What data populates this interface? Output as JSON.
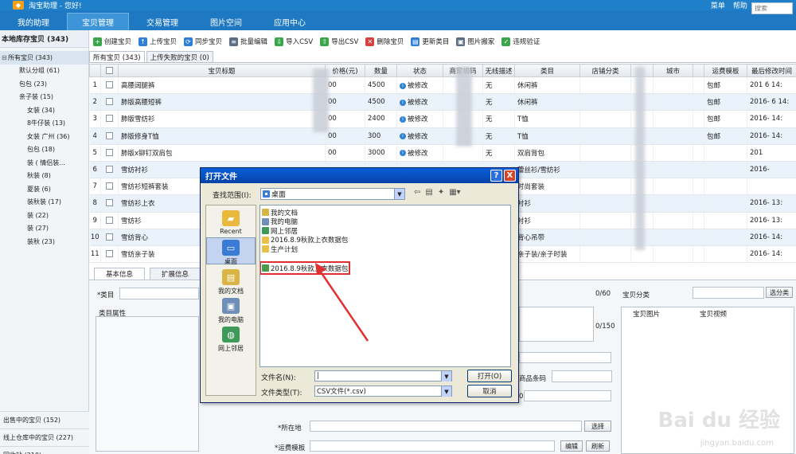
{
  "titlebar": {
    "title": "淘宝助理 - 您好!",
    "menu": "菜单",
    "help": "帮助"
  },
  "nav": {
    "tabs": [
      "我的助理",
      "宝贝管理",
      "交易管理",
      "图片空间",
      "应用中心"
    ],
    "active_index": 1
  },
  "left": {
    "header": "本地库存宝贝 (343)",
    "tree": [
      {
        "label": "所有宝贝 (343)",
        "root": true
      },
      {
        "label": "默认分组 (61)"
      },
      {
        "label": "包包 (23)"
      },
      {
        "label": "亲子装 (15)"
      },
      {
        "label": "女装 (34)"
      },
      {
        "label": "8牛仔装 (13)"
      },
      {
        "label": "女装 广州 (36)"
      },
      {
        "label": "包包 (18)"
      },
      {
        "label": "装 ( 情侣装..."
      },
      {
        "label": "秋装 (8)"
      },
      {
        "label": "夏装 (6)"
      },
      {
        "label": "装秋装 (17)"
      },
      {
        "label": "装 (22)"
      },
      {
        "label": "装 (27)"
      },
      {
        "label": "装秋 (23)"
      }
    ],
    "bottom": [
      "出售中的宝贝 (152)",
      "线上仓库中的宝贝 (227)",
      "回收站 (210)"
    ]
  },
  "toolbar": {
    "buttons": [
      {
        "label": "创建宝贝",
        "color": "#3aa64c",
        "glyph": "+"
      },
      {
        "label": "上传宝贝",
        "color": "#2f7fd6",
        "glyph": "↑"
      },
      {
        "label": "同步宝贝",
        "color": "#2f7fd6",
        "glyph": "⟳"
      },
      {
        "label": "批量编辑",
        "color": "#5a6d82",
        "glyph": "≡"
      },
      {
        "label": "导入CSV",
        "color": "#3aa64c",
        "glyph": "⇩"
      },
      {
        "label": "导出CSV",
        "color": "#3aa64c",
        "glyph": "⇧"
      },
      {
        "label": "删除宝贝",
        "color": "#d84040",
        "glyph": "✕"
      },
      {
        "label": "更新类目",
        "color": "#2f7fd6",
        "glyph": "▤"
      },
      {
        "label": "图片搬家",
        "color": "#5a6d82",
        "glyph": "▣"
      },
      {
        "label": "违规验证",
        "color": "#3aa64c",
        "glyph": "✓"
      }
    ],
    "search_placeholder": "搜索"
  },
  "subtabs": [
    "所有宝贝 (343)",
    "上传失败的宝贝 (0)"
  ],
  "grid": {
    "headers": [
      "",
      "",
      "宝贝标题",
      "价格(元)",
      "数量",
      "状态",
      "商家编码",
      "无线描述",
      "类目",
      "店铺分类",
      "",
      "城市",
      "",
      "运费模板",
      "最后修改时间"
    ],
    "rows": [
      {
        "n": "1",
        "title": "高腰阔腿裤",
        "price": "00",
        "qty": "4500",
        "status": "被修改",
        "code": "",
        "wireless": "无",
        "cat": "休闲裤",
        "ship": "包邮",
        "time": "201    6  14:"
      },
      {
        "n": "2",
        "title": "肺版高腰短裤",
        "price": "00",
        "qty": "4500",
        "status": "被修改",
        "code": "",
        "wireless": "无",
        "cat": "休闲裤",
        "ship": "包邮",
        "time": "2016-  6  14:"
      },
      {
        "n": "3",
        "title": "肺版雪纺衫",
        "price": "00",
        "qty": "2400",
        "status": "被修改",
        "code": "",
        "wireless": "无",
        "cat": "T恤",
        "ship": "包邮",
        "time": "2016-   14:"
      },
      {
        "n": "4",
        "title": "肺版修身T恤",
        "price": "00",
        "qty": "300",
        "status": "被修改",
        "code": "",
        "wireless": "无",
        "cat": "T恤",
        "ship": "包邮",
        "time": "2016-   14:"
      },
      {
        "n": "5",
        "title": "肺版x铆钉双肩包",
        "price": "00",
        "qty": "3000",
        "status": "被修改",
        "code": "",
        "wireless": "无",
        "cat": "双肩背包",
        "ship": "",
        "time": "201"
      },
      {
        "n": "6",
        "title": "雪纺衬衫",
        "price": "",
        "qty": "",
        "status": "",
        "code": "",
        "wireless": "",
        "cat": "蕾丝衫/雪纺衫",
        "ship": "",
        "time": "2016-"
      },
      {
        "n": "7",
        "title": "雪纺衫短裤套装",
        "price": "",
        "qty": "",
        "status": "",
        "code": "",
        "wireless": "",
        "cat": "时尚套装",
        "ship": "",
        "time": ""
      },
      {
        "n": "8",
        "title": "雪纺衫上衣",
        "price": "",
        "qty": "",
        "status": "",
        "code": "",
        "wireless": "",
        "cat": "衬衫",
        "ship": "",
        "time": "2016-   13:"
      },
      {
        "n": "9",
        "title": "雪纺衫",
        "price": "",
        "qty": "",
        "status": "",
        "code": "",
        "wireless": "",
        "cat": "衬衫",
        "ship": "",
        "time": "2016-   13:"
      },
      {
        "n": "10",
        "title": "雪纺背心",
        "price": "",
        "qty": "",
        "status": "",
        "code": "",
        "wireless": "",
        "cat": "背心吊带",
        "ship": "",
        "time": "2016-   14:"
      },
      {
        "n": "11",
        "title": "雪纺亲子装",
        "price": "",
        "qty": "",
        "status": "",
        "code": "",
        "wireless": "",
        "cat": "亲子装/亲子时装",
        "ship": "",
        "time": "2016-   14:"
      }
    ]
  },
  "edit": {
    "tabs": [
      "基本信息",
      "扩展信息"
    ],
    "category_label": "*类目",
    "attr_label": "类目属性",
    "count_60": "0/60",
    "count_150": "0/150",
    "shop_category_label": "宝贝分类",
    "select_category_btn": "选分类",
    "pic_tab": "宝贝图片",
    "video_tab": "宝贝视频",
    "barcode_label": "商品条码",
    "location_label": "*所在地",
    "choose_btn": "选择",
    "shipping_label": "*运费模板",
    "edit_btn": "编辑",
    "refresh_btn": "刷新",
    "zero": "0"
  },
  "dialog": {
    "title": "打开文件",
    "help": "?",
    "close": "X",
    "lookin_label": "查找范围(I):",
    "lookin_value": "桌面",
    "places": [
      "Recent",
      "桌面",
      "我的文档",
      "我的电脑",
      "网上邻居"
    ],
    "files": [
      {
        "name": "我的文档",
        "icon": "doc"
      },
      {
        "name": "我的电脑",
        "icon": "pc"
      },
      {
        "name": "网上邻居",
        "icon": "net"
      },
      {
        "name": "2016.8.9秋款上衣数据包",
        "icon": "folder"
      },
      {
        "name": "生产计划",
        "icon": "folder"
      },
      {
        "name": "2016.8.9秋款上衣数据包",
        "icon": "csv",
        "highlight": true
      }
    ],
    "filename_label": "文件名(N):",
    "filename_value": "|",
    "filetype_label": "文件类型(T):",
    "filetype_value": "CSV文件(*.csv)",
    "open_btn": "打开(O)",
    "cancel_btn": "取消"
  },
  "watermark": {
    "main": "Bai du 经验",
    "sub": "jingyan.baidu.com"
  }
}
